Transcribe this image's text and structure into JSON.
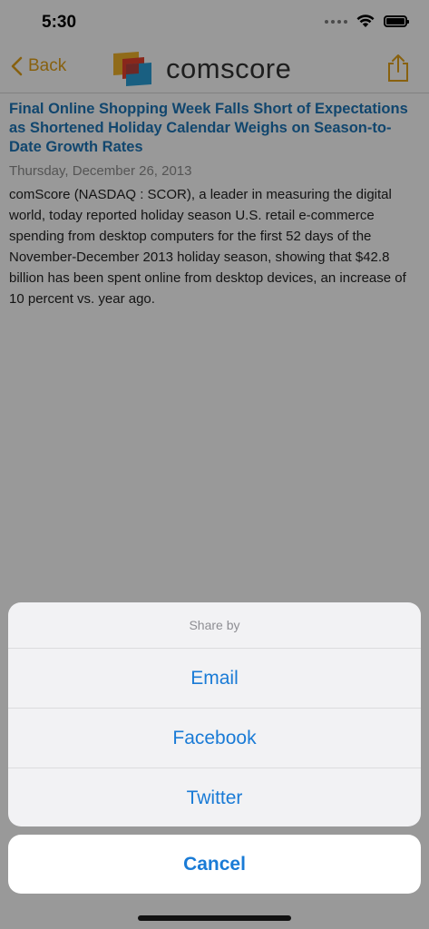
{
  "status_bar": {
    "time": "5:30"
  },
  "nav": {
    "back_label": "Back",
    "logo_text": "comscore"
  },
  "article": {
    "headline": "Final Online Shopping Week Falls Short of Expectations as Shortened Holiday Calendar Weighs on Season-to-Date Growth Rates",
    "date": "Thursday, December 26, 2013",
    "body": "comScore (NASDAQ : SCOR), a leader in measuring the digital world, today reported holiday season U.S. retail e-commerce spending from desktop computers for the first 52 days of the November-December 2013 holiday season, showing that $42.8 billion has been spent online from desktop devices, an increase of 10 percent vs. year ago."
  },
  "share_sheet": {
    "title": "Share by",
    "options": [
      "Email",
      "Facebook",
      "Twitter"
    ],
    "cancel_label": "Cancel"
  },
  "colors": {
    "accent": "#e3a21a",
    "headline": "#1d76b7",
    "action": "#1a7bd6"
  }
}
